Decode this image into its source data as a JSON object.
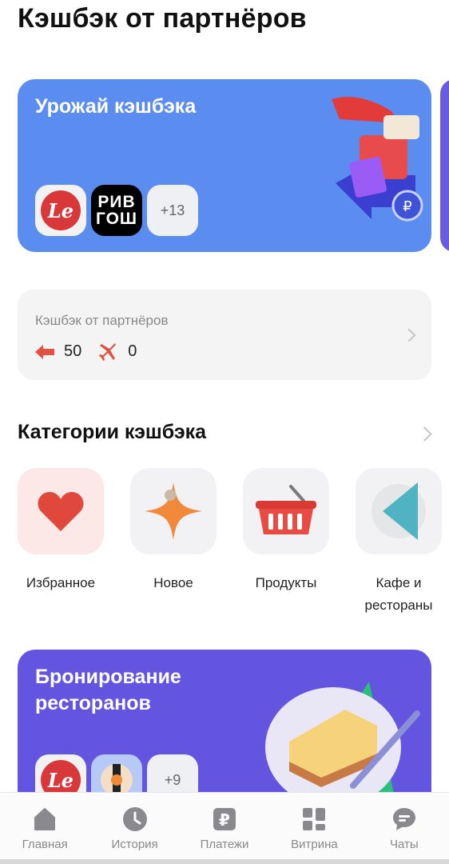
{
  "page": {
    "title": "Кэшбэк от партнёров"
  },
  "promo_harvest": {
    "title": "Урожай кэшбэка",
    "logos": [
      {
        "name": "le-logo",
        "text": "Le"
      },
      {
        "name": "rivgosh-logo",
        "line1": "РИВ",
        "line2": "ГОШ"
      },
      {
        "name": "more-partners",
        "text": "+13"
      }
    ],
    "accent": "#5b8cf0"
  },
  "partner_cashback": {
    "title": "Кэшбэк от партнёров",
    "items": [
      {
        "icon": "arrow-left-icon",
        "value": "50",
        "color": "#e0523f"
      },
      {
        "icon": "airplane-icon",
        "value": "0",
        "color": "#e0523f"
      }
    ]
  },
  "categories": {
    "header": "Категории кэшбэка",
    "items": [
      {
        "icon": "heart-icon",
        "label": "Избранное",
        "color": "#e0483c",
        "bg": "#fde8e8"
      },
      {
        "icon": "sparkle-star-icon",
        "label": "Новое",
        "color": "#f08a3a",
        "bg": "#f2f2f4"
      },
      {
        "icon": "shopping-basket-icon",
        "label": "Продукты",
        "color": "#e0483c",
        "bg": "#f2f2f4"
      },
      {
        "icon": "cafe-plate-icon",
        "label": "Кафе и рестораны",
        "color": "#4fb3c2",
        "bg": "#f2f2f4"
      }
    ]
  },
  "promo_restaurants": {
    "title": "Бронирование ресторанов",
    "logos": [
      {
        "name": "le-logo",
        "text": "Le"
      },
      {
        "name": "sushi-logo",
        "text": ""
      },
      {
        "name": "more-partners",
        "text": "+9"
      }
    ],
    "accent": "#6355e0"
  },
  "nav": {
    "items": [
      {
        "icon": "home-icon",
        "label": "Главная"
      },
      {
        "icon": "clock-icon",
        "label": "История"
      },
      {
        "icon": "ruble-icon",
        "label": "Платежи"
      },
      {
        "icon": "grid-icon",
        "label": "Витрина"
      },
      {
        "icon": "chat-icon",
        "label": "Чаты"
      }
    ]
  }
}
